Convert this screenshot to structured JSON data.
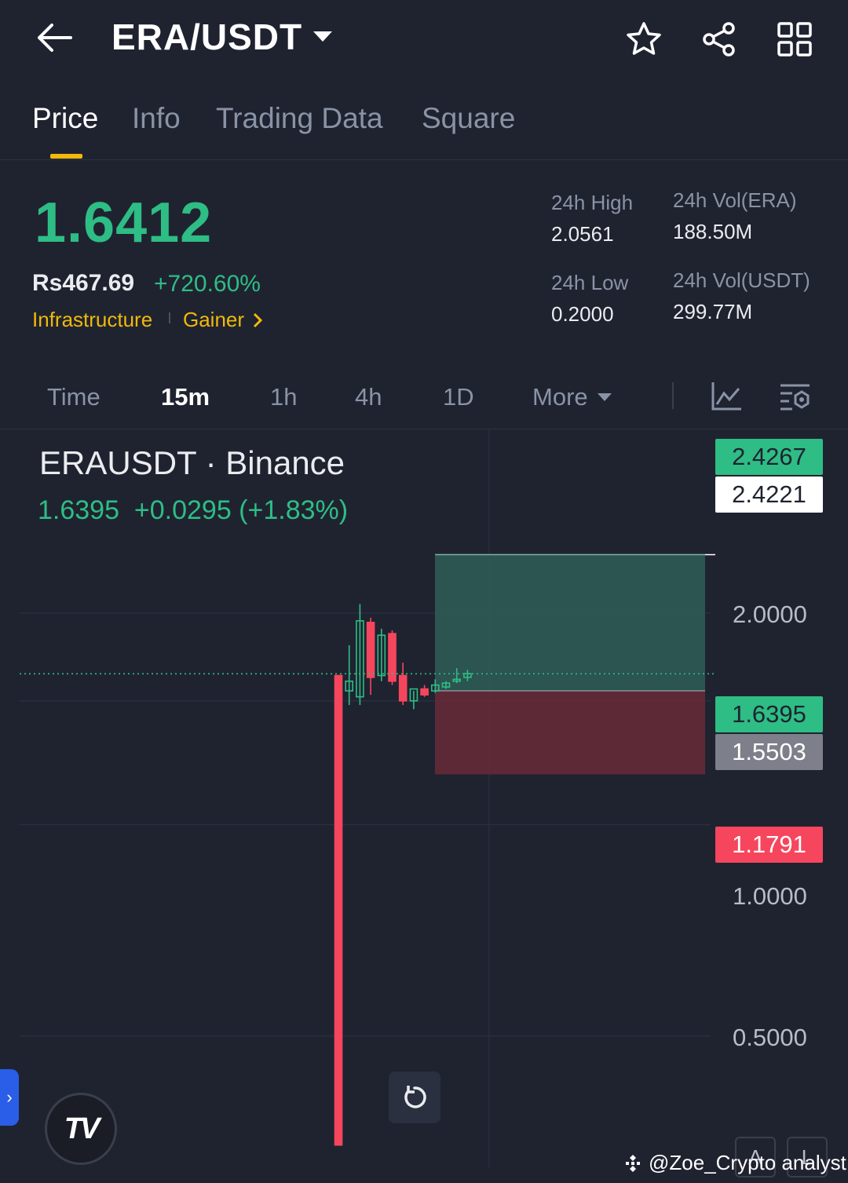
{
  "header": {
    "pair": "ERA/USDT"
  },
  "tabs": [
    {
      "label": "Price"
    },
    {
      "label": "Info"
    },
    {
      "label": "Trading Data"
    },
    {
      "label": "Square"
    }
  ],
  "price": {
    "last": "1.6412",
    "fiat": "Rs467.69",
    "change_pct": "+720.60%",
    "tags": [
      "Infrastructure",
      "Gainer"
    ]
  },
  "stats": {
    "high_label": "24h High",
    "high_value": "2.0561",
    "low_label": "24h Low",
    "low_value": "0.2000",
    "vol_base_label": "24h Vol(ERA)",
    "vol_base_value": "188.50M",
    "vol_quote_label": "24h Vol(USDT)",
    "vol_quote_value": "299.77M"
  },
  "timeframes": {
    "items": [
      "Time",
      "15m",
      "1h",
      "4h",
      "1D"
    ],
    "more": "More",
    "selected": "15m"
  },
  "chart": {
    "symbol_title": "ERAUSDT · Binance",
    "last_line": "1.6395  +0.0295 (+1.83%)",
    "y_axis_labels": [
      "2.0000",
      "1.0000",
      "0.5000"
    ],
    "price_tags": [
      {
        "value": "2.4267",
        "kind": "target"
      },
      {
        "value": "2.4221",
        "kind": "crosshair"
      },
      {
        "value": "1.6395",
        "kind": "last"
      },
      {
        "value": "1.5503",
        "kind": "entry"
      },
      {
        "value": "1.1791",
        "kind": "stop"
      }
    ],
    "colors": {
      "up": "#2ebd85",
      "down": "#f6465d",
      "profit_zone": "#2f5d57",
      "loss_zone": "#6a2a38"
    }
  },
  "chart_data": {
    "type": "candlestick",
    "title": "ERAUSDT · Binance",
    "ylabel": "",
    "y_scale": "log",
    "ylim": [
      0.33,
      2.6
    ],
    "last_price": 1.6395,
    "position_tool": {
      "target": 2.4221,
      "entry": 1.5503,
      "stop": 1.1791
    },
    "candles": [
      {
        "open": 1.63,
        "high": 1.63,
        "low": 0.35,
        "close": 0.35
      },
      {
        "open": 1.55,
        "high": 1.8,
        "low": 1.48,
        "close": 1.6
      },
      {
        "open": 1.52,
        "high": 2.06,
        "low": 1.48,
        "close": 1.95
      },
      {
        "open": 1.94,
        "high": 1.97,
        "low": 1.53,
        "close": 1.62
      },
      {
        "open": 1.63,
        "high": 1.9,
        "low": 1.6,
        "close": 1.86
      },
      {
        "open": 1.87,
        "high": 1.89,
        "low": 1.58,
        "close": 1.6
      },
      {
        "open": 1.63,
        "high": 1.7,
        "low": 1.48,
        "close": 1.5
      },
      {
        "open": 1.5,
        "high": 1.55,
        "low": 1.46,
        "close": 1.56
      },
      {
        "open": 1.56,
        "high": 1.58,
        "low": 1.52,
        "close": 1.53
      },
      {
        "open": 1.55,
        "high": 1.61,
        "low": 1.54,
        "close": 1.58
      },
      {
        "open": 1.57,
        "high": 1.6,
        "low": 1.56,
        "close": 1.59
      },
      {
        "open": 1.6,
        "high": 1.67,
        "low": 1.59,
        "close": 1.61
      },
      {
        "open": 1.62,
        "high": 1.66,
        "low": 1.6,
        "close": 1.64
      }
    ]
  },
  "watermark": "@Zoe_Crypto analyst",
  "tv_logo_text": "TV",
  "side_tab_glyph": "›",
  "mini_buttons": [
    "A",
    "L"
  ]
}
